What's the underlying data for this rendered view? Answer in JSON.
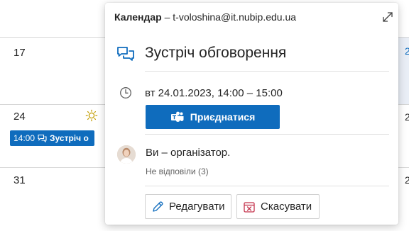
{
  "calendar": {
    "days": [
      "17",
      "24",
      "31"
    ],
    "side_days": [
      "2",
      "2",
      "2"
    ],
    "event_chip": {
      "time": "14:00",
      "title": "Зустріч о"
    }
  },
  "popup": {
    "calendar_label": "Календар",
    "separator": " – ",
    "account": "t-voloshina@it.nubip.edu.ua",
    "title": "Зустріч обговорення",
    "datetime": "вт 24.01.2023, 14:00 – 15:00",
    "join_label": "Приєднатися",
    "organizer_text": "Ви – організатор.",
    "no_response": "Не відповіли (3)",
    "edit_label": "Редагувати",
    "cancel_label": "Скасувати"
  },
  "colors": {
    "accent": "#0f6cbd",
    "cancel_icon": "#c4314b"
  },
  "icons": [
    "sun-icon",
    "chat-icon",
    "expand-icon",
    "meeting-icon",
    "clock-icon",
    "teams-icon",
    "pencil-icon",
    "calendar-cancel-icon"
  ]
}
